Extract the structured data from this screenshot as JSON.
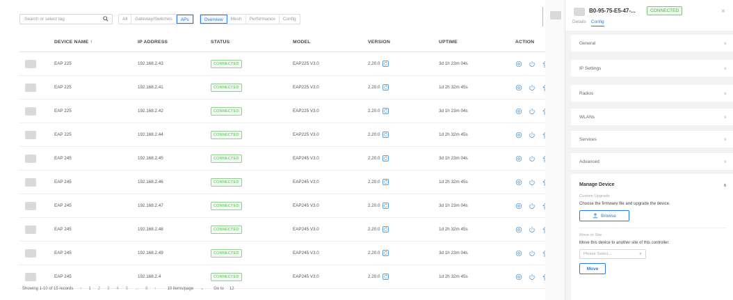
{
  "toolbar": {
    "search_placeholder": "Search or select tag",
    "filters": [
      "All",
      "Gateway/Switches",
      "APs"
    ],
    "active_filter": "APs",
    "tabs": [
      "Overview",
      "Mesh",
      "Performance",
      "Config"
    ],
    "active_tab": "Overview"
  },
  "table": {
    "headers": {
      "name": "DEVICE NAME ↑",
      "ip": "IP ADDRESS",
      "status": "STATUS",
      "model": "MODEL",
      "version": "VERSION",
      "uptime": "UPTIME",
      "action": "ACTION"
    },
    "rows": [
      {
        "name": "EAP 225",
        "ip": "192.168.2.43",
        "status": "CONNECTED",
        "model": "EAP225 V3.0",
        "version": "2.20.0",
        "uptime": "3d 1h 23m 04s"
      },
      {
        "name": "EAP 225",
        "ip": "192.168.2.41",
        "status": "CONNECTED",
        "model": "EAP225 V3.0",
        "version": "2.20.0",
        "uptime": "1d 2h 32m 45s"
      },
      {
        "name": "EAP 225",
        "ip": "192.168.2.42",
        "status": "CONNECTED",
        "model": "EAP225 V3.0",
        "version": "2.20.0",
        "uptime": "3d 1h 23m 04s"
      },
      {
        "name": "EAP 225",
        "ip": "192.168.2.44",
        "status": "CONNECTED",
        "model": "EAP225 V3.0",
        "version": "2.20.0",
        "uptime": "1d 2h 32m 45s"
      },
      {
        "name": "EAP 245",
        "ip": "192.168.2.45",
        "status": "CONNECTED",
        "model": "EAP245 V3.0",
        "version": "2.20.0",
        "uptime": "3d 1h 23m 04s"
      },
      {
        "name": "EAP 245",
        "ip": "192.168.2.46",
        "status": "CONNECTED",
        "model": "EAP245 V3.0",
        "version": "2.20.0",
        "uptime": "1d 2h 32m 45s"
      },
      {
        "name": "EAP 245",
        "ip": "192.168.2.47",
        "status": "CONNECTED",
        "model": "EAP245 V3.0",
        "version": "2.20.0",
        "uptime": "3d 1h 23m 04s"
      },
      {
        "name": "EAP 245",
        "ip": "192.168.2.48",
        "status": "CONNECTED",
        "model": "EAP245 V3.0",
        "version": "2.20.0",
        "uptime": "1d 2h 32m 45s"
      },
      {
        "name": "EAP 245",
        "ip": "192.168.2.49",
        "status": "CONNECTED",
        "model": "EAP245 V3.0",
        "version": "2.20.0",
        "uptime": "3d 1h 23m 04s"
      },
      {
        "name": "EAP 245",
        "ip": "192.168.2.4",
        "status": "CONNECTED",
        "model": "EAP245 V3.0",
        "version": "2.20.0",
        "uptime": "1d 2h 32m 45s"
      }
    ]
  },
  "pager": {
    "summary": "Showing 1-10 of 15 records",
    "prev": "‹",
    "pages": [
      "1",
      "2",
      "3",
      "4",
      "5",
      "...",
      "8"
    ],
    "active_page": "1",
    "next": "›",
    "per_page": "10 items/page",
    "goto_label": "Go to",
    "goto_value": "12"
  },
  "panel": {
    "mac": "B0-95-75-E5-47-...",
    "status": "CONNECTED",
    "close": "×",
    "tabs": [
      "Details",
      "Config"
    ],
    "active_tab": "Config",
    "sections": [
      "General",
      "IP Settings",
      "Radios",
      "WLANs",
      "Services",
      "Advanced"
    ],
    "manage": {
      "title": "Manage Device",
      "upgrade_label": "Custom Upgrade",
      "upgrade_desc": "Choose the firmware file and upgrade the device.",
      "browse": "Browse",
      "move_label": "Move to Site",
      "move_desc": "Move this device to another site of this controller.",
      "select_placeholder": "Please Select...",
      "move_button": "Move"
    }
  },
  "colors": {
    "accent": "#2b7bd6",
    "connected": "#5bb35a"
  }
}
